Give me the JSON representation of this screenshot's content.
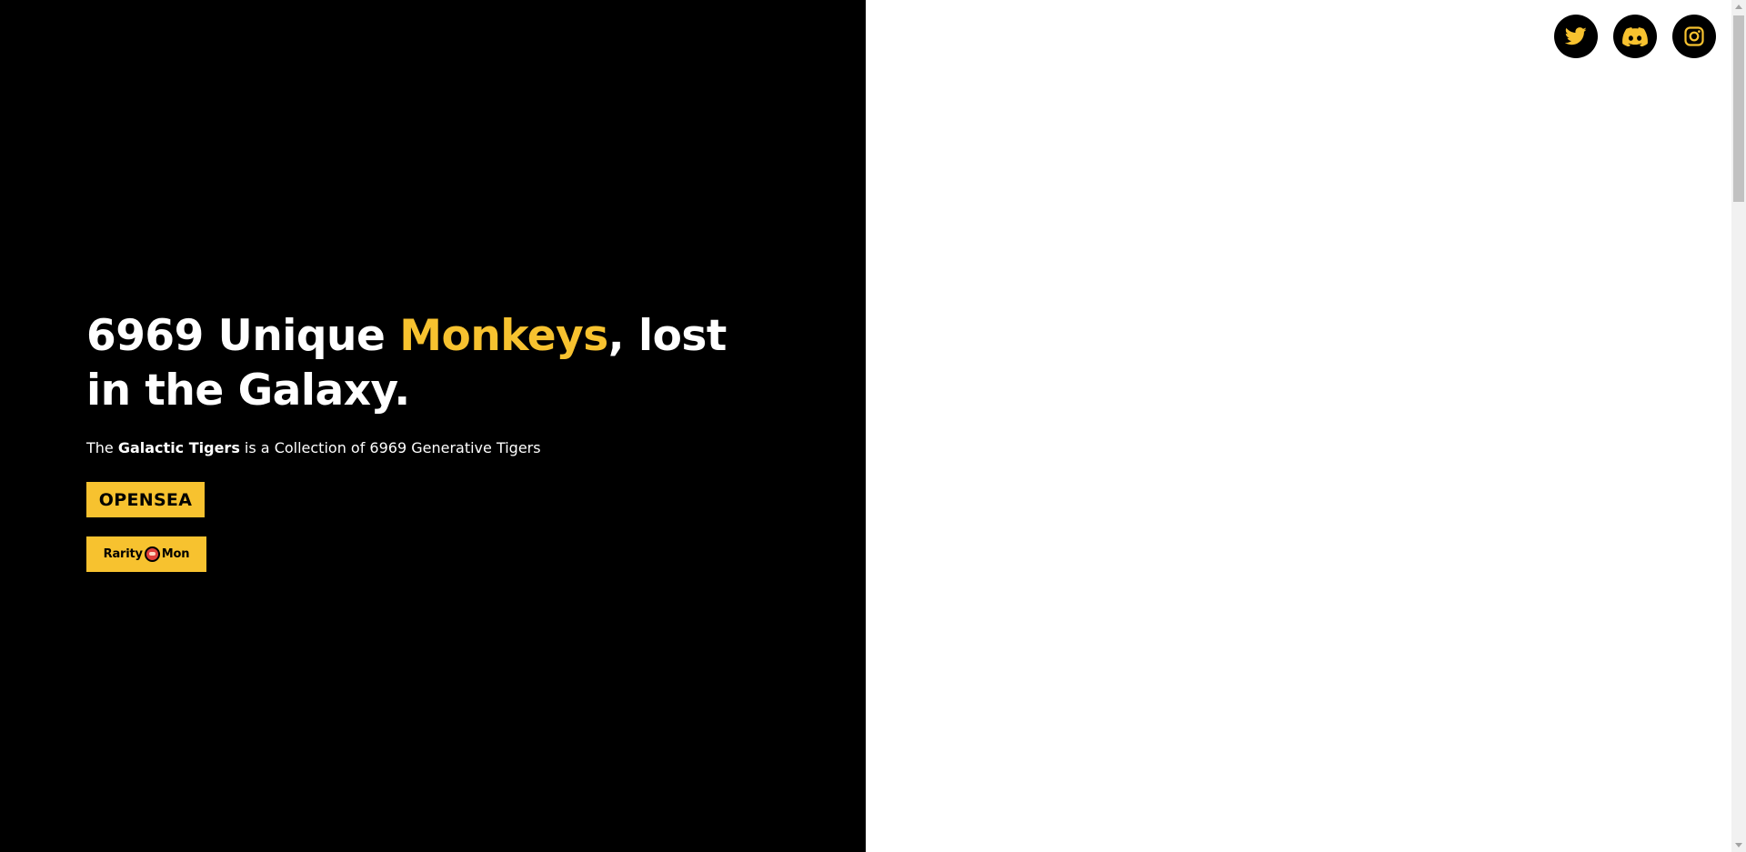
{
  "colors": {
    "accent": "#f7c22f",
    "left_background": "#000000",
    "right_background": "#ffffff",
    "text": "#ffffff"
  },
  "hero": {
    "headline_part1": "6969 Unique ",
    "headline_accent": "Monkeys",
    "headline_part2": ", lost in the Galaxy.",
    "subtitle_prefix": "The ",
    "subtitle_bold": "Galactic Tigers",
    "subtitle_suffix": " is a Collection of 6969 Generative Tigers"
  },
  "buttons": {
    "opensea_label": "OPENSEA",
    "raritymon_part1": "Rarity",
    "raritymon_part2": "Mon"
  },
  "socials": [
    {
      "icon": "twitter-icon"
    },
    {
      "icon": "discord-icon"
    },
    {
      "icon": "instagram-icon"
    }
  ]
}
